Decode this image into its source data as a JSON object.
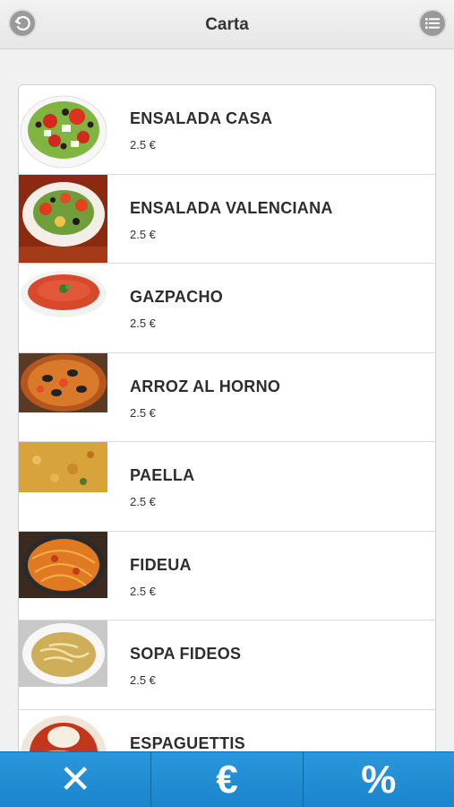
{
  "header": {
    "title": "Carta",
    "back_icon": "back-arrow-icon",
    "menu_icon": "list-icon"
  },
  "items": [
    {
      "name": "ENSALADA CASA",
      "price": "2.5 €"
    },
    {
      "name": "ENSALADA VALENCIANA",
      "price": "2.5 €"
    },
    {
      "name": "GAZPACHO",
      "price": "2.5 €"
    },
    {
      "name": "ARROZ AL HORNO",
      "price": "2.5 €"
    },
    {
      "name": "PAELLA",
      "price": "2.5 €"
    },
    {
      "name": "FIDEUA",
      "price": "2.5 €"
    },
    {
      "name": "SOPA FIDEOS",
      "price": "2.5 €"
    },
    {
      "name": "ESPAGUETTIS",
      "price": ""
    }
  ],
  "footer": {
    "cancel_label": "✕",
    "price_label": "€",
    "discount_label": "%"
  },
  "colors": {
    "footer_blue": "#1f8ad1",
    "header_bg": "#ececec"
  }
}
